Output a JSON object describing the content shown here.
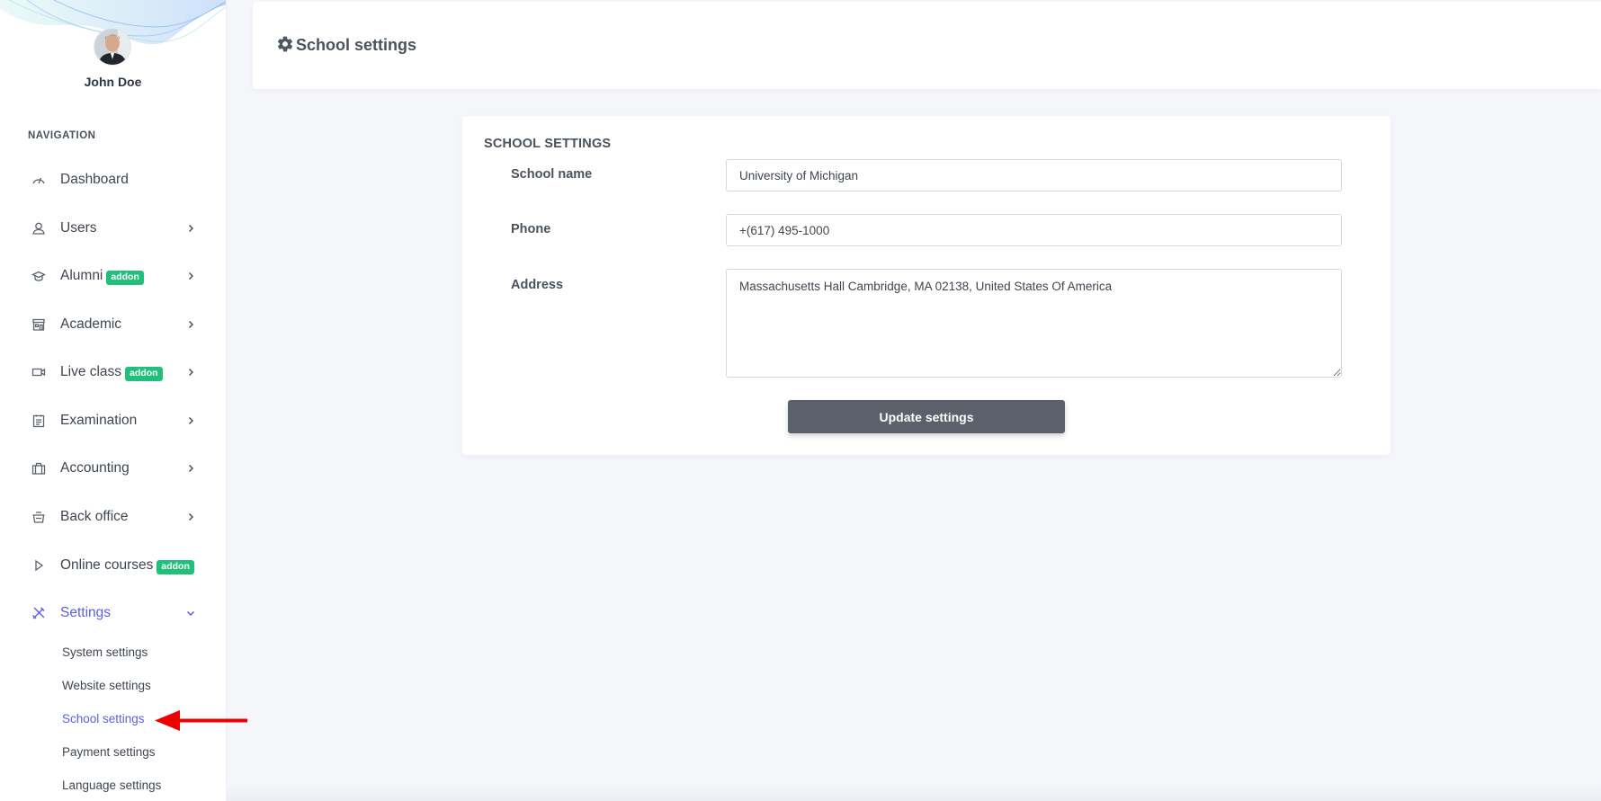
{
  "user": {
    "name": "John Doe",
    "avatar_icon": "user-avatar-photo"
  },
  "sidebar": {
    "heading": "NAVIGATION",
    "items": [
      {
        "label": "Dashboard",
        "icon": "gauge-icon",
        "has_chevron": false
      },
      {
        "label": "Users",
        "icon": "user-icon",
        "has_chevron": true
      },
      {
        "label": "Alumni",
        "icon": "graduation-cap-icon",
        "badge": "addon",
        "has_chevron": true
      },
      {
        "label": "Academic",
        "icon": "building-icon",
        "has_chevron": true
      },
      {
        "label": "Live class",
        "icon": "video-camera-icon",
        "badge": "addon",
        "has_chevron": true
      },
      {
        "label": "Examination",
        "icon": "clipboard-icon",
        "has_chevron": true
      },
      {
        "label": "Accounting",
        "icon": "briefcase-icon",
        "has_chevron": true
      },
      {
        "label": "Back office",
        "icon": "basket-icon",
        "has_chevron": true
      },
      {
        "label": "Online courses",
        "icon": "play-icon",
        "badge": "addon",
        "has_chevron": false
      },
      {
        "label": "Settings",
        "icon": "tools-icon",
        "has_chevron": true,
        "expanded": true,
        "active": true
      }
    ],
    "settings_submenu": [
      {
        "label": "System settings"
      },
      {
        "label": "Website settings"
      },
      {
        "label": "School settings",
        "active": true
      },
      {
        "label": "Payment settings"
      },
      {
        "label": "Language settings"
      }
    ]
  },
  "header": {
    "title": "School settings",
    "icon": "gear-icon"
  },
  "form": {
    "title": "SCHOOL SETTINGS",
    "fields": {
      "school_name": {
        "label": "School name",
        "value": "University of Michigan"
      },
      "phone": {
        "label": "Phone",
        "value": "+(617) 495-1000"
      },
      "address": {
        "label": "Address",
        "value": "Massachusetts Hall Cambridge, MA 02138, United States Of America"
      }
    },
    "submit_label": "Update settings"
  },
  "colors": {
    "accent": "#5b5fe3",
    "addon_badge": "#20c07a",
    "button": "#5a616b",
    "annotation_arrow": "#ee0000"
  }
}
